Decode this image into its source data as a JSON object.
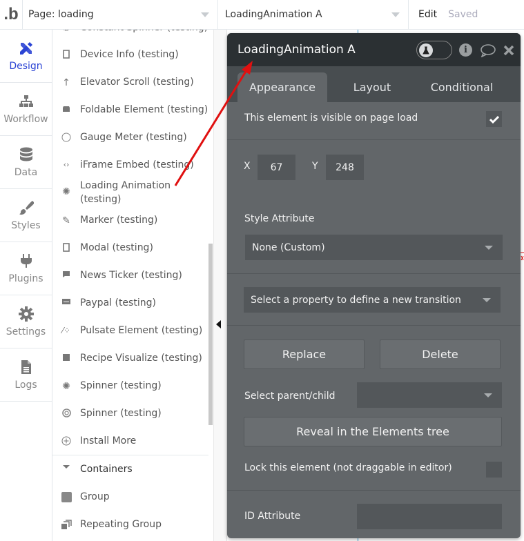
{
  "topbar": {
    "logo": ".b",
    "page_selector": "Page: loading",
    "element_selector": "LoadingAnimation A",
    "edit_label": "Edit",
    "save_status": "Saved"
  },
  "leftnav": {
    "items": [
      {
        "label": "Design",
        "icon": "design-icon",
        "active": true
      },
      {
        "label": "Workflow",
        "icon": "workflow-icon"
      },
      {
        "label": "Data",
        "icon": "database-icon"
      },
      {
        "label": "Styles",
        "icon": "brush-icon"
      },
      {
        "label": "Plugins",
        "icon": "plug-icon"
      },
      {
        "label": "Settings",
        "icon": "gear-icon"
      },
      {
        "label": "Logs",
        "icon": "document-icon"
      }
    ]
  },
  "element_list": {
    "items": [
      {
        "label": "Constant Spinner (testing)",
        "icon": "spinner-icon"
      },
      {
        "label": "Device Info (testing)",
        "icon": "device-icon"
      },
      {
        "label": "Elevator Scroll (testing)",
        "icon": "arrow-up-icon"
      },
      {
        "label": "Foldable Element (testing)",
        "icon": "folder-icon"
      },
      {
        "label": "Gauge Meter (testing)",
        "icon": "circle-icon"
      },
      {
        "label": "iFrame Embed (testing)",
        "icon": "code-icon"
      },
      {
        "label": "Loading Animation",
        "label2": "(testing)",
        "icon": "spinner-icon"
      },
      {
        "label": "Marker (testing)",
        "icon": "pencil-icon"
      },
      {
        "label": "Modal (testing)",
        "icon": "device-icon"
      },
      {
        "label": "News Ticker (testing)",
        "icon": "message-icon"
      },
      {
        "label": "Paypal (testing)",
        "icon": "credit-card-icon"
      },
      {
        "label": "Pulsate Element (testing)",
        "icon": "magic-wand-icon"
      },
      {
        "label": "Recipe Visualize (testing)",
        "icon": "square-icon"
      },
      {
        "label": "Spinner (testing)",
        "icon": "spinner-icon"
      },
      {
        "label": "Spinner (testing)",
        "icon": "life-ring-icon"
      },
      {
        "label": "Install More",
        "icon": "plus-circle-icon"
      }
    ],
    "containers_header": "Containers",
    "containers": [
      {
        "label": "Group",
        "icon": "group-icon"
      },
      {
        "label": "Repeating Group",
        "icon": "repeating-group-icon"
      }
    ]
  },
  "editor": {
    "title": "LoadingAnimation A",
    "tabs": [
      {
        "label": "Appearance",
        "active": true
      },
      {
        "label": "Layout"
      },
      {
        "label": "Conditional"
      }
    ],
    "visible_on_load_label": "This element is visible on page load",
    "visible_on_load_checked": true,
    "x_label": "X",
    "x_value": "67",
    "y_label": "Y",
    "y_value": "248",
    "style_attribute_label": "Style Attribute",
    "style_attribute_value": "None (Custom)",
    "transition_placeholder": "Select a property to define a new transition",
    "replace_button": "Replace",
    "delete_button": "Delete",
    "parent_child_label": "Select parent/child",
    "parent_child_value": "",
    "reveal_button": "Reveal in the Elements tree",
    "lock_label": "Lock this element (not draggable in editor)",
    "lock_checked": false,
    "id_attribute_label": "ID Attribute",
    "id_attribute_value": ""
  },
  "colors": {
    "accent": "#2b44d4",
    "editor_bg": "#626669",
    "editor_header": "#2b3033",
    "annotation_arrow": "#e01010"
  }
}
